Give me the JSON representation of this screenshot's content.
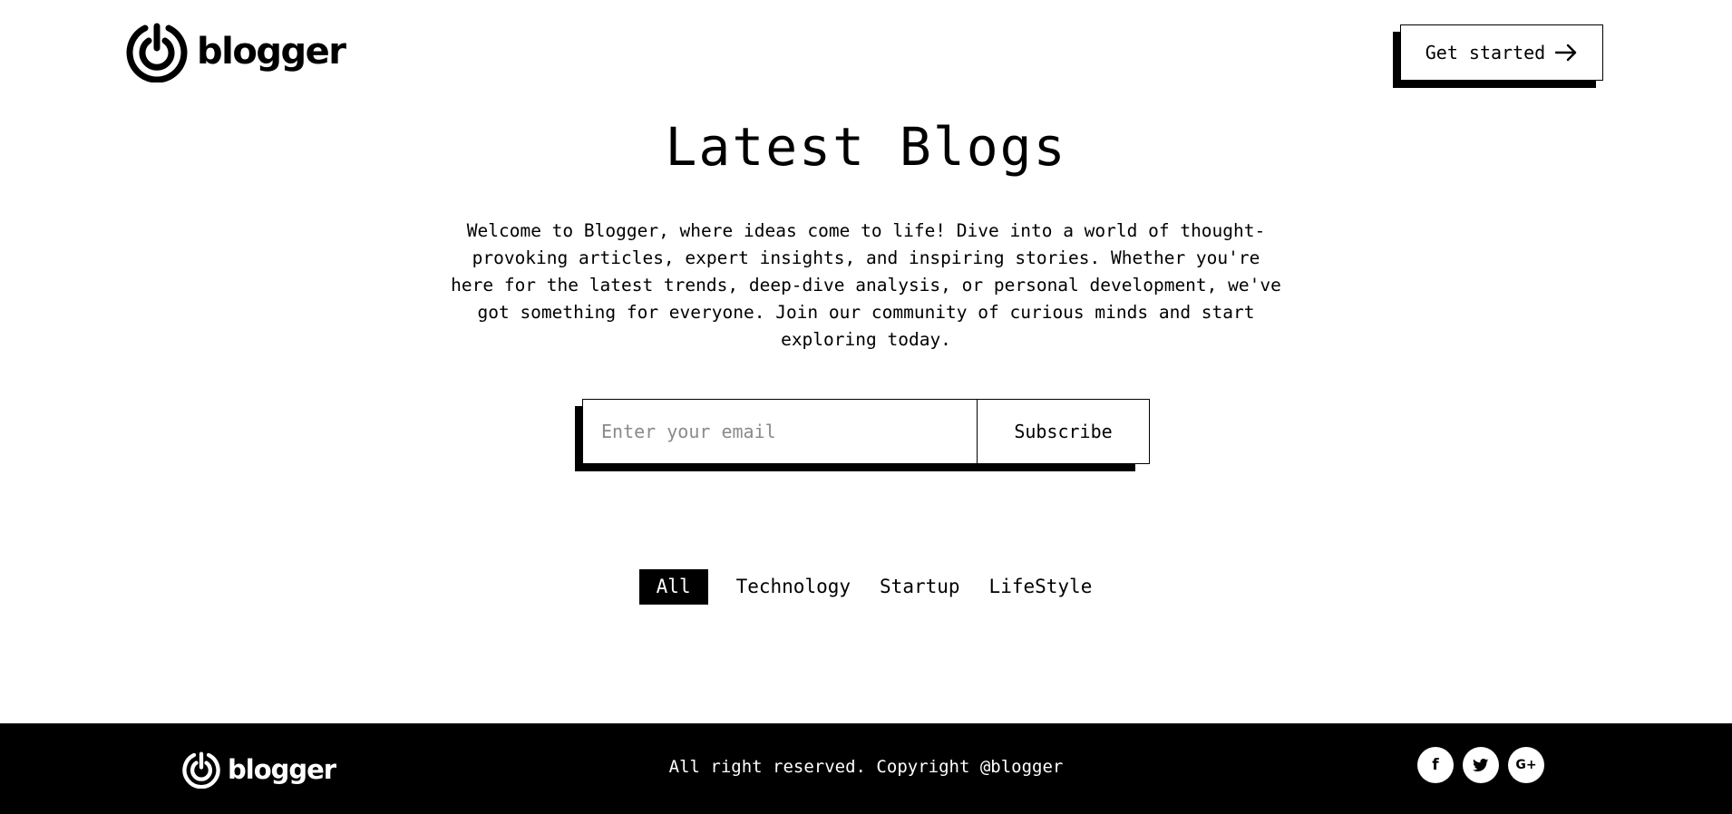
{
  "header": {
    "logo_text": "blogger",
    "cta_label": "Get started",
    "cta_icon": "arrow-right-icon"
  },
  "hero": {
    "title": "Latest Blogs",
    "description": "Welcome to Blogger, where ideas come to life! Dive into a world of thought-provoking articles, expert insights, and inspiring stories. Whether you're here for the latest trends, deep-dive analysis, or personal development, we've got something for everyone. Join our community of curious minds and start exploring today."
  },
  "subscribe": {
    "placeholder": "Enter your email",
    "value": "",
    "button_label": "Subscribe"
  },
  "filters": [
    {
      "label": "All",
      "active": true
    },
    {
      "label": "Technology",
      "active": false
    },
    {
      "label": "Startup",
      "active": false
    },
    {
      "label": "LifeStyle",
      "active": false
    }
  ],
  "footer": {
    "logo_text": "blogger",
    "copyright": "All right reserved. Copyright @blogger",
    "socials": [
      {
        "icon": "facebook-icon",
        "glyph": "f"
      },
      {
        "icon": "twitter-icon",
        "glyph": ""
      },
      {
        "icon": "google-plus-icon",
        "glyph": "G+"
      }
    ]
  },
  "colors": {
    "background": "#ffffff",
    "text": "#000000",
    "footer_background": "#000000",
    "placeholder": "#8a8a8a"
  }
}
